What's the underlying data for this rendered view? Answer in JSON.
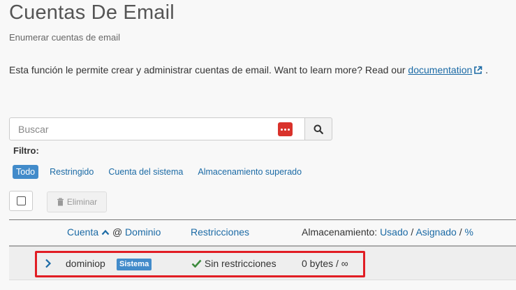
{
  "header": {
    "title": "Cuentas De Email",
    "subtitle": "Enumerar cuentas de email"
  },
  "intro": {
    "text": "Esta función le permite crear y administrar cuentas de email. Want to learn more? Read our ",
    "link": "documentation",
    "suffix": "."
  },
  "search": {
    "placeholder": "Buscar"
  },
  "filter": {
    "label": "Filtro:",
    "options": [
      "Todo",
      "Restringido",
      "Cuenta del sistema",
      "Almacenamiento superado"
    ],
    "active": "Todo"
  },
  "actions": {
    "delete_label": "Eliminar"
  },
  "table": {
    "headers": {
      "account": "Cuenta",
      "at": "@",
      "domain": "Dominio",
      "restrictions": "Restricciones",
      "storage": "Almacenamiento:",
      "used": "Usado",
      "sep1": "/",
      "assigned": "Asignado",
      "sep2": "/",
      "percent": "%"
    },
    "rows": [
      {
        "account": "dominiop",
        "badge": "Sistema",
        "restriction": "Sin restricciones",
        "storage": "0 bytes / ∞"
      }
    ]
  },
  "colors": {
    "link": "#1b6aa5",
    "active_filter": "#428bca",
    "highlight": "#e11d24",
    "success": "#3c8a3c"
  }
}
